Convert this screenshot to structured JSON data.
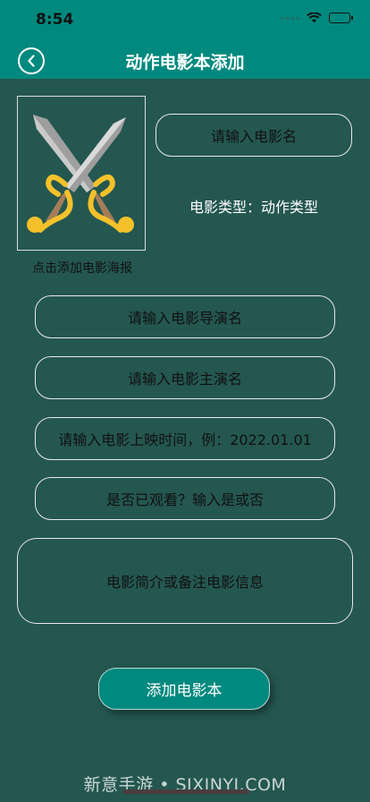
{
  "status": {
    "time": "8:54"
  },
  "nav": {
    "title": "动作电影本添加"
  },
  "poster": {
    "caption": "点击添加电影海报"
  },
  "form": {
    "title_placeholder": "请输入电影名",
    "genre_label": "电影类型：动作类型",
    "director_placeholder": "请输入电影导演名",
    "actor_placeholder": "请输入电影主演名",
    "date_placeholder": "请输入电影上映时间，例：2022.01.01",
    "watched_placeholder": "是否已观看？输入是或否",
    "notes_placeholder": "电影简介或备注电影信息"
  },
  "actions": {
    "submit_label": "添加电影本"
  },
  "watermark": "新意手游 • SJXINYI.COM",
  "colors": {
    "header": "#00897e",
    "background": "#245750",
    "button": "#00897e"
  }
}
